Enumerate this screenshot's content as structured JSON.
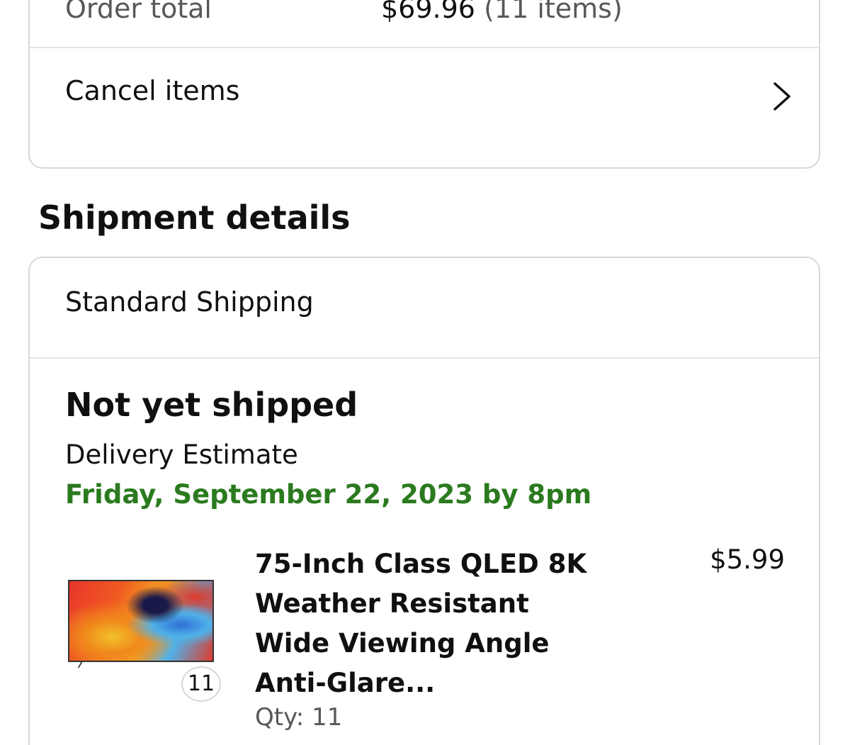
{
  "order_summary": {
    "total_label": "Order total",
    "total_amount": "$69.96",
    "total_count": "(11 items)",
    "cancel_label": "Cancel items"
  },
  "shipment": {
    "section_title": "Shipment details",
    "method": "Standard Shipping",
    "status": "Not yet shipped",
    "delivery_label": "Delivery Estimate",
    "delivery_date": "Friday, September 22, 2023 by 8pm",
    "delivery_date_color": "#2b7a1f",
    "item": {
      "title": "75-Inch Class QLED 8K Weather Resistant Wide Viewing Angle Anti-Glare...",
      "price": "$5.99",
      "qty_badge": "11",
      "qty_text": "Qty: 11",
      "thumbnail_icon": "tv-thumbnail"
    }
  },
  "icons": {
    "cancel_chevron": "chevron-right-icon"
  }
}
